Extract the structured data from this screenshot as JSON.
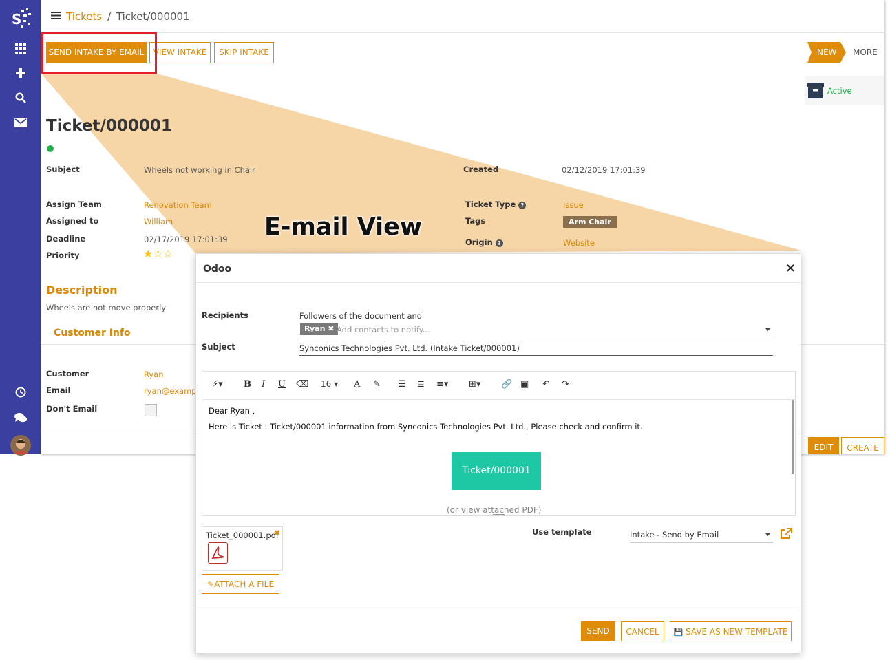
{
  "breadcrumb": {
    "parent": "Tickets",
    "separator": "/",
    "current": "Ticket/000001"
  },
  "actions": {
    "send_intake": "SEND INTAKE BY EMAIL",
    "view_intake": "VIEW INTAKE",
    "skip_intake": "SKIP INTAKE"
  },
  "stage": {
    "current": "NEW",
    "more": "MORE"
  },
  "smart_button": {
    "label": "Active"
  },
  "ticket": {
    "title": "Ticket/000001",
    "subject_label": "Subject",
    "subject": "Wheels not working in Chair",
    "created_label": "Created",
    "created": "02/12/2019 17:01:39",
    "assign_team_label": "Assign Team",
    "assign_team": "Renovation Team",
    "assigned_to_label": "Assigned to",
    "assigned_to": "William",
    "deadline_label": "Deadline",
    "deadline": "02/17/2019 17:01:39",
    "priority_label": "Priority",
    "ticket_type_label": "Ticket Type",
    "ticket_type": "Issue",
    "tags_label": "Tags",
    "tag": "Arm Chair",
    "origin_label": "Origin",
    "origin": "Website",
    "description_heading": "Description",
    "description": "Wheels are not move properly",
    "customer_info_heading": "Customer Info",
    "customer_label": "Customer",
    "customer": "Ryan",
    "email_label": "Email",
    "email": "ryan@exampl",
    "dont_email_label": "Don't Email"
  },
  "form_buttons": {
    "edit": "EDIT",
    "create": "CREATE"
  },
  "annotation": {
    "text": "E-mail View"
  },
  "modal": {
    "title": "Odoo",
    "close": "×",
    "recipients_label": "Recipients",
    "followers_text": "Followers of the document and",
    "recipient_tag": "Ryan",
    "add_contacts_placeholder": "Add contacts to notify...",
    "subject_label": "Subject",
    "subject_value": "Synconics Technologies Pvt. Ltd. (Intake Ticket/000001)",
    "font_size": "16",
    "body_greeting": "Dear Ryan ,",
    "body_line": "Here is Ticket : Ticket/000001 information from Synconics Technologies Pvt. Ltd., Please check and confirm it.",
    "body_button": "Ticket/000001",
    "body_footer": "(or view attached PDF)",
    "attachment_name": "Ticket_000001.pdf",
    "attach_button": "ATTACH A FILE",
    "use_template_label": "Use template",
    "template_value": "Intake - Send by Email",
    "send": "SEND",
    "cancel": "CANCEL",
    "save_template": "SAVE AS NEW TEMPLATE"
  },
  "colors": {
    "sidebar": "#3a3fa0",
    "accent": "#e08c0b",
    "teal": "#1fc8a4",
    "highlight_red": "#e0202a"
  }
}
